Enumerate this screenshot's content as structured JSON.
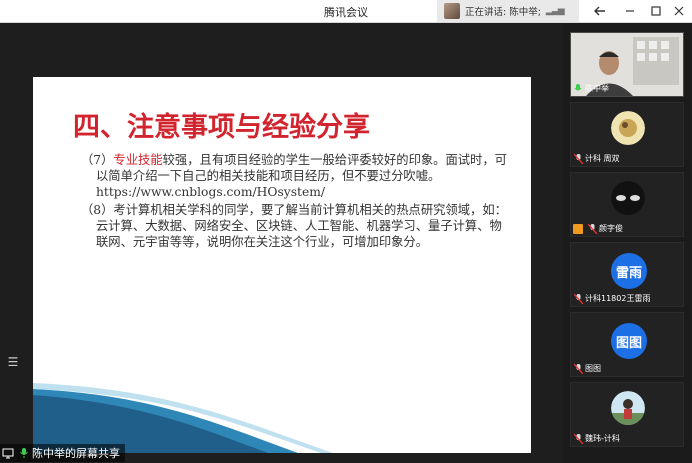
{
  "window": {
    "title": "腾讯会议",
    "speaking_text": "正在讲话: 陈中举;",
    "controls": [
      "back-icon",
      "minimize-icon",
      "maximize-icon",
      "close-icon"
    ]
  },
  "slide": {
    "title": "四、注意事项与经验分享",
    "p7_prefix": "（7）",
    "p7_highlight": "专业技能",
    "p7_rest": "较强，且有项目经验的学生一般给评委较好的印象。面试时，可以简单介绍一下自己的相关技能和项目经历，但不要过分吹嘘。https://www.cnblogs.com/HOsystem/",
    "p8": "（8）考计算机相关学科的同学，要了解当前计算机相关的热点研究领域，如：云计算、大数据、网络安全、区块链、人工智能、机器学习、量子计算、物联网、元宇宙等等，说明你在关注这个行业，可增加印象分。"
  },
  "share_label": "陈中举的屏幕共享",
  "participants": [
    {
      "name": "陈中举",
      "avatar": "camera-video"
    },
    {
      "name": "计科 周双",
      "avatar": "photo"
    },
    {
      "name": "颜字俊",
      "avatar": "photo"
    },
    {
      "name": "计科11802王雷雨",
      "avatar_text": "雷雨"
    },
    {
      "name": "图图",
      "avatar_text": "图图"
    },
    {
      "name": "魏玮-计科",
      "avatar": "photo"
    }
  ],
  "colors": {
    "accent_red": "#d2242e",
    "avatar_blue": "#1d6fe6",
    "wave_blue": "#2f87b7"
  }
}
